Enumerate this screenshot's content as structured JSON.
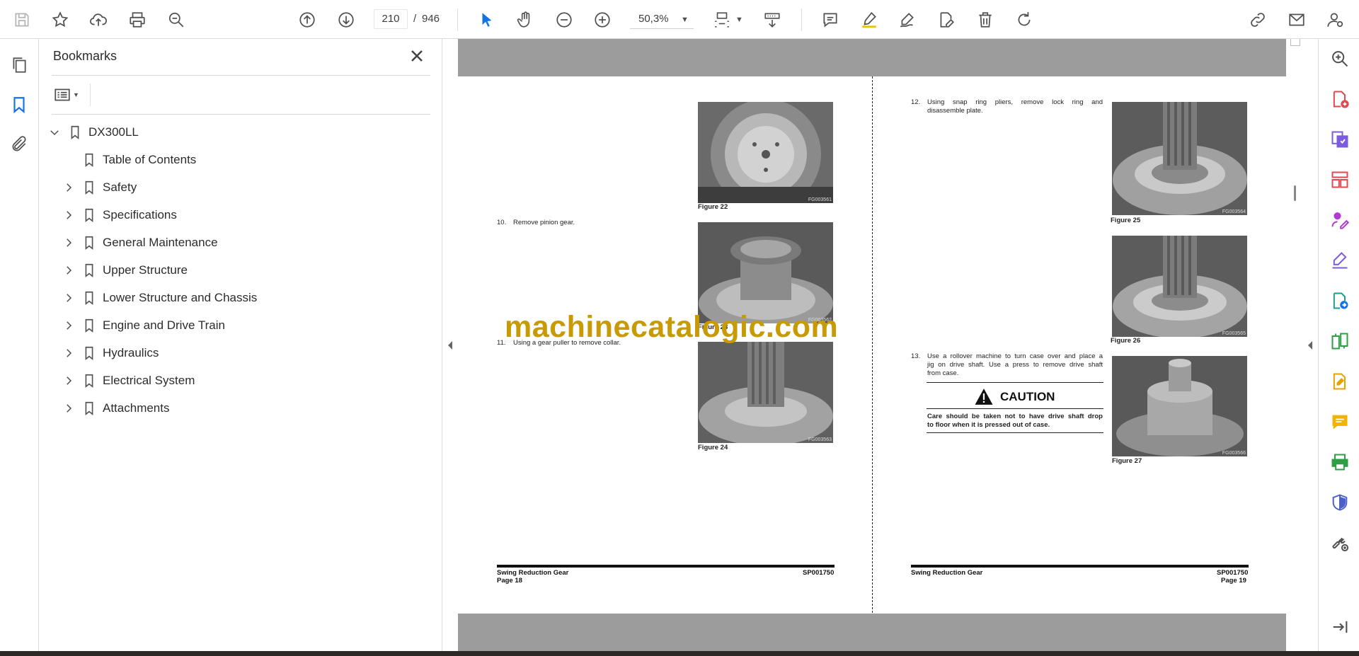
{
  "toolbar": {
    "current_page": "210",
    "page_separator": "/",
    "total_pages": "946",
    "zoom": "50,3%"
  },
  "bookmarks": {
    "title": "Bookmarks",
    "root": "DX300LL",
    "items": [
      {
        "label": "Table of Contents",
        "expandable": false
      },
      {
        "label": "Safety",
        "expandable": true
      },
      {
        "label": "Specifications",
        "expandable": true
      },
      {
        "label": "General Maintenance",
        "expandable": true
      },
      {
        "label": "Upper Structure",
        "expandable": true
      },
      {
        "label": "Lower Structure and Chassis",
        "expandable": true
      },
      {
        "label": "Engine and Drive Train",
        "expandable": true
      },
      {
        "label": "Hydraulics",
        "expandable": true
      },
      {
        "label": "Electrical System",
        "expandable": true
      },
      {
        "label": "Attachments",
        "expandable": true
      }
    ]
  },
  "document": {
    "left_page": {
      "step10": {
        "num": "10.",
        "text": "Remove pinion gear."
      },
      "step11": {
        "num": "11.",
        "text": "Using a gear puller to remove collar."
      },
      "fig22": {
        "caption": "Figure 22",
        "id": "FG003561"
      },
      "fig23": {
        "caption": "Figure 23",
        "id": "FG003562"
      },
      "fig24": {
        "caption": "Figure 24",
        "id": "FG003563"
      },
      "footer_title": "Swing Reduction Gear",
      "footer_code": "SP001750",
      "footer_page": "Page 18"
    },
    "right_page": {
      "step12": {
        "num": "12.",
        "line1": "Using snap ring pliers, remove lock ring and",
        "line2": "disassemble plate."
      },
      "step13": {
        "num": "13.",
        "line1": "Use a rollover machine to turn case over and place a",
        "line2": "jig on drive shaft. Use a press to remove drive shaft",
        "line3": "from case."
      },
      "caution_title": "CAUTION",
      "caution_line1": "Care should be taken not to have drive shaft drop",
      "caution_line2": "to floor when it is pressed out of case.",
      "fig25": {
        "caption": "Figure 25",
        "id": "FG003564"
      },
      "fig26": {
        "caption": "Figure 26",
        "id": "FG003565"
      },
      "fig27": {
        "caption": "Figure 27",
        "id": "FG003566"
      },
      "footer_title": "Swing Reduction Gear",
      "footer_code": "SP001750",
      "footer_page": "Page 19"
    },
    "watermark": "machinecatalogic.com"
  },
  "colors": {
    "accent_blue": "#1473e6",
    "watermark": "#c79a06",
    "page_gray": "#9c9c9c"
  },
  "icons": {
    "toolbar": [
      "save-icon",
      "bookmark-star-icon",
      "upload-cloud-icon",
      "print-icon",
      "zoom-search-icon",
      "prev-page-icon",
      "next-page-icon",
      "select-cursor-icon",
      "hand-pan-icon",
      "zoom-out-icon",
      "zoom-in-icon",
      "page-fit-icon",
      "scroll-mode-icon",
      "comment-icon",
      "highlight-icon",
      "sign-icon",
      "edit-text-icon",
      "delete-icon",
      "rotate-icon",
      "share-link-icon",
      "email-icon",
      "account-icon"
    ],
    "right_rail": [
      "zoom-tool-icon",
      "create-pdf-icon",
      "export-pdf-icon",
      "organize-pages-icon",
      "fill-sign-icon",
      "sign-request-icon",
      "scan-ocr-icon",
      "compare-icon",
      "edit-pdf-icon",
      "comment-tool-icon",
      "print-production-icon",
      "protect-icon",
      "more-tools-icon",
      "collapse-rail-icon"
    ]
  }
}
